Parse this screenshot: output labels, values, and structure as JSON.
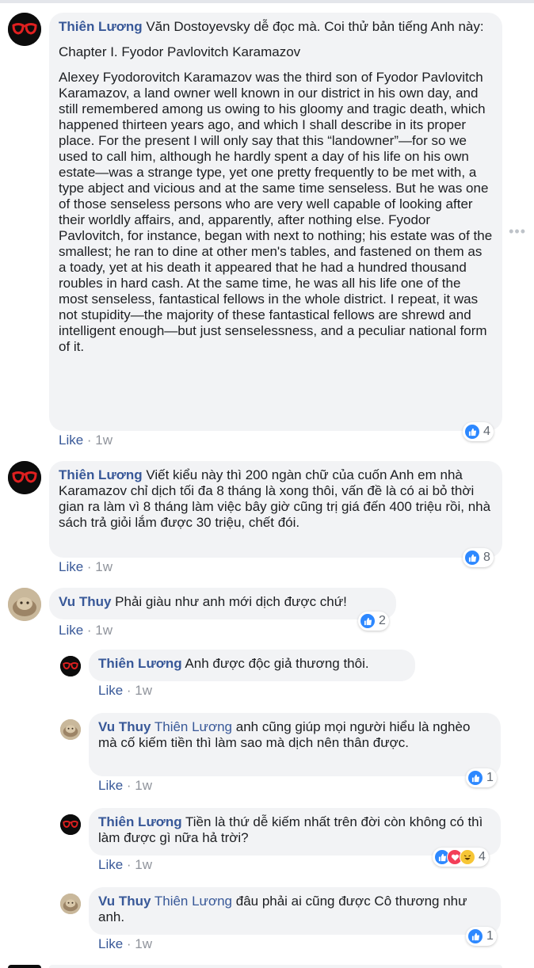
{
  "more_options": "•••",
  "comments": [
    {
      "author": "Thiên Lương",
      "text_inline": "Văn Dostoyevsky dễ đọc mà. Coi thử bản tiếng Anh này:",
      "paragraph_1": "Chapter I. Fyodor Pavlovitch Karamazov",
      "paragraph_2": "Alexey Fyodorovitch Karamazov was the third son of Fyodor Pavlovitch Karamazov, a land owner well known in our district in his own day, and still remembered among us owing to his gloomy and tragic death, which happened thirteen years ago, and which I shall describe in its proper place. For the present I will only say that this “landowner”—for so we used to call him, although he hardly spent a day of his life on his own estate—was a strange type, yet one pretty frequently to be met with, a type abject and vicious and at the same time senseless. But he was one of those senseless persons who are very well capable of looking after their worldly affairs, and, apparently, after nothing else. Fyodor Pavlovitch, for instance, began with next to nothing; his estate was of the smallest; he ran to dine at other men's tables, and fastened on them as a toady, yet at his death it appeared that he had a hundred thousand roubles in hard cash. At the same time, he was all his life one of the most senseless, fantastical fellows in the whole district. I repeat, it was not stupidity—the majority of these fantastical fellows are shrewd and intelligent enough—but just senselessness, and a peculiar national form of it.",
      "like_label": "Like",
      "time": "1w",
      "reaction_count": "4"
    },
    {
      "author": "Thiên Lương",
      "text": "Viết kiểu này thì 200 ngàn chữ của cuốn Anh em nhà Karamazov chỉ dịch tối đa 8 tháng là xong thôi, vấn đề là có ai bỏ thời gian ra làm vì 8 tháng làm việc bây giờ cũng trị giá đến 400 triệu rồi, nhà sách trả giỏi lắm được 30 triệu, chết đói.",
      "like_label": "Like",
      "time": "1w",
      "reaction_count": "8"
    },
    {
      "author": "Vu Thuy",
      "text": "Phải giàu như anh mới dịch được chứ!",
      "like_label": "Like",
      "time": "1w",
      "reaction_count": "2"
    }
  ],
  "replies": [
    {
      "author": "Thiên Lương",
      "text": "Anh được độc giả thương thôi.",
      "like_label": "Like",
      "time": "1w"
    },
    {
      "author": "Vu Thuy",
      "mention": "Thiên Lương",
      "text": "anh cũng giúp mọi người hiểu là nghèo mà cố kiếm tiền thì làm sao mà dịch nên thân được.",
      "like_label": "Like",
      "time": "1w",
      "reaction_count": "1"
    },
    {
      "author": "Thiên Lương",
      "text": "Tiền là thứ dễ kiếm nhất trên đời còn không có thì làm được gì nữa hả trời?",
      "like_label": "Like",
      "time": "1w",
      "reaction_count": "4"
    },
    {
      "author": "Vu Thuy",
      "mention": "Thiên Lương",
      "text": "đâu phải ai cũng được Cô thương như anh.",
      "like_label": "Like",
      "time": "1w",
      "reaction_count": "1"
    }
  ],
  "colors": {
    "link": "#385898",
    "meta": "#90949c",
    "bubble": "#f2f3f5",
    "like_reaction": "#2d88ff",
    "love_reaction": "#f33e58",
    "haha_reaction": "#f7c636"
  }
}
